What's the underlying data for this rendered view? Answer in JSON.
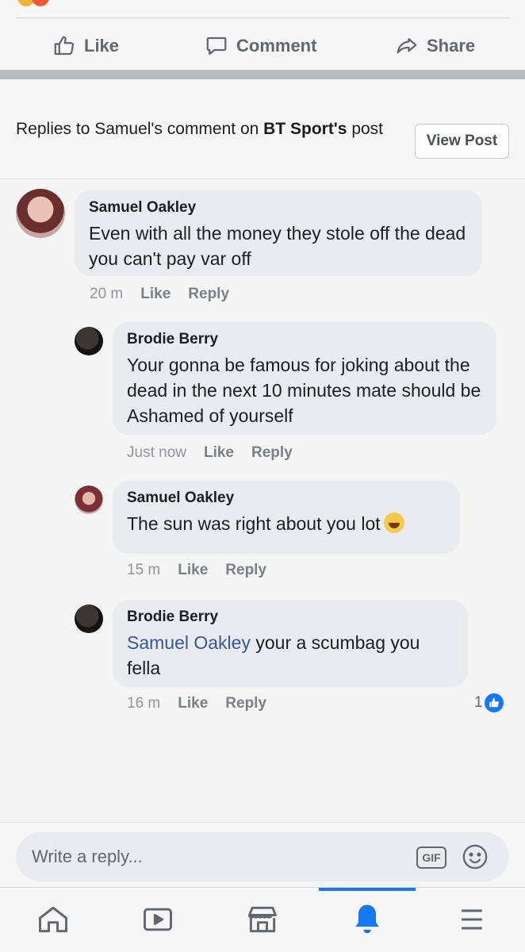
{
  "post_actions": {
    "like": "Like",
    "comment": "Comment",
    "share": "Share"
  },
  "banner": {
    "prefix": "Replies to Samuel's comment on ",
    "page": "BT Sport's",
    "suffix": " post",
    "view_post": "View Post"
  },
  "comments": [
    {
      "author": "Samuel Oakley",
      "text": "Even with all the money they stole off the dead you can't pay var off",
      "time": "20 m",
      "like": "Like",
      "reply": "Reply"
    },
    {
      "author": "Brodie Berry",
      "text": "Your gonna be famous for joking about the dead in the next 10 minutes mate should be Ashamed of yourself",
      "time": "Just now",
      "like": "Like",
      "reply": "Reply"
    },
    {
      "author": "Samuel Oakley",
      "text": "The sun was right about you lot",
      "time": "15 m",
      "like": "Like",
      "reply": "Reply"
    },
    {
      "author": "Brodie Berry",
      "mention": "Samuel Oakley",
      "text": " your a scumbag you fella",
      "time": "16 m",
      "like": "Like",
      "reply": "Reply",
      "reaction_count": "1"
    }
  ],
  "composer": {
    "placeholder": "Write a reply...",
    "gif": "GIF"
  },
  "nav": [
    "home-icon",
    "watch-icon",
    "marketplace-icon",
    "notifications-icon",
    "menu-icon"
  ],
  "colors": {
    "accent": "#1877f2",
    "mention": "#385898"
  }
}
